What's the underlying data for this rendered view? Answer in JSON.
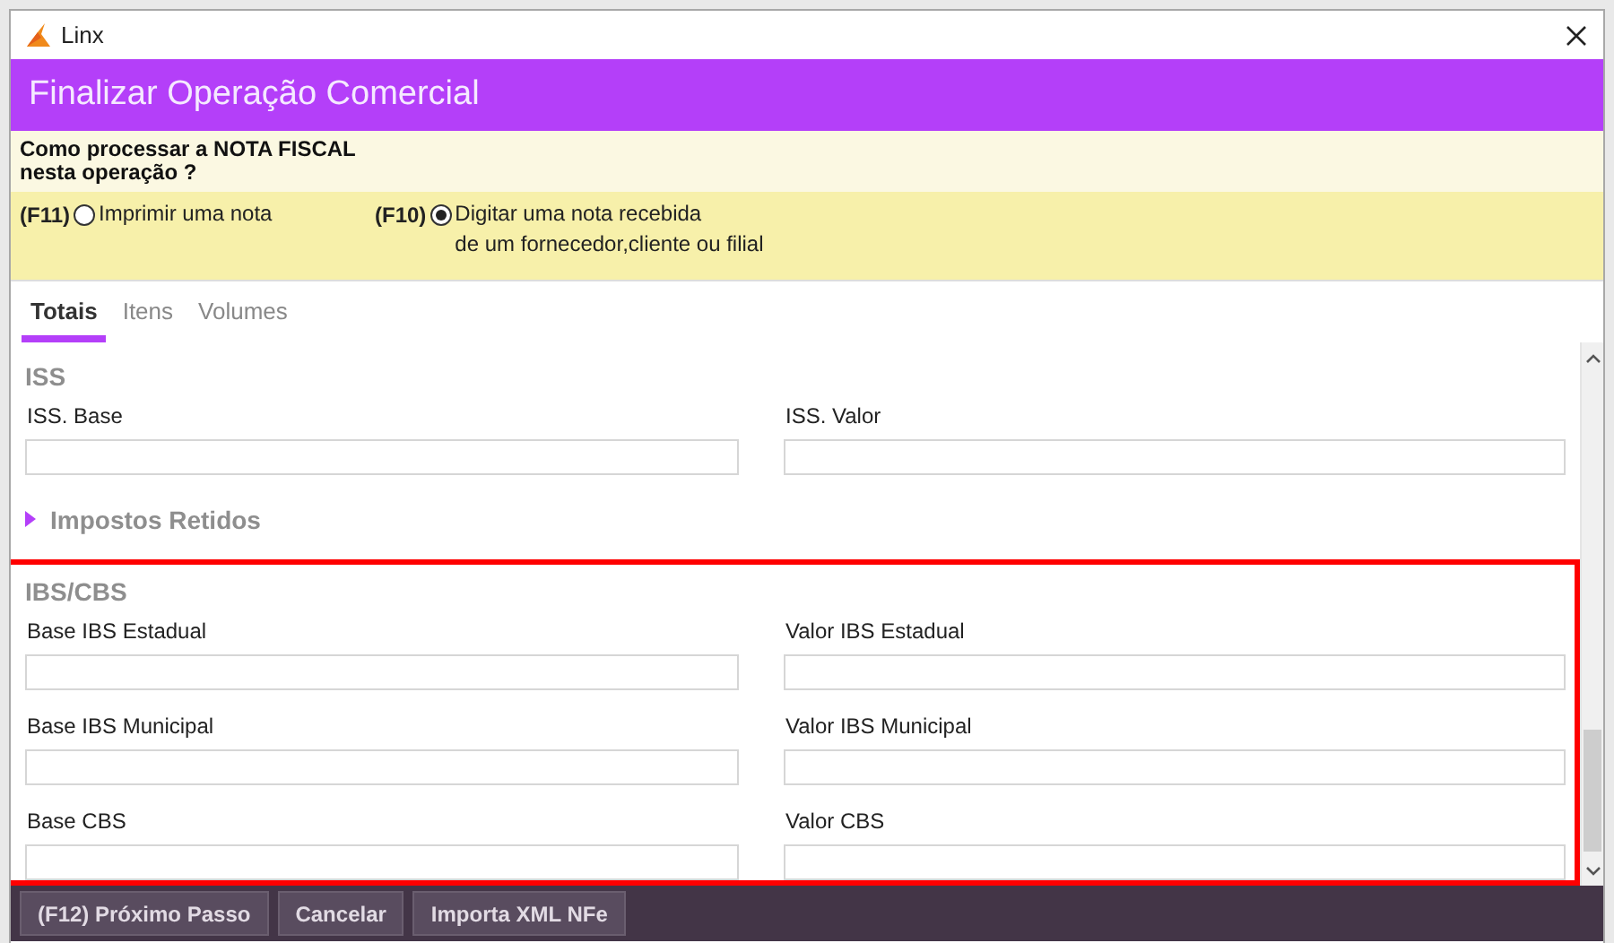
{
  "window": {
    "title": "Linx"
  },
  "header": {
    "title": "Finalizar Operação Comercial"
  },
  "question": {
    "lines": [
      "Como processar a NOTA FISCAL",
      "nesta operação ?"
    ]
  },
  "options": [
    {
      "shortcut": "(F11)",
      "label_lines": [
        "Imprimir uma nota"
      ],
      "selected": false
    },
    {
      "shortcut": "(F10)",
      "label_lines": [
        "Digitar uma nota recebida",
        "de um fornecedor,cliente ou filial"
      ],
      "selected": true
    }
  ],
  "tabs": [
    {
      "label": "Totais",
      "selected": true
    },
    {
      "label": "Itens",
      "selected": false
    },
    {
      "label": "Volumes",
      "selected": false
    }
  ],
  "sections": [
    {
      "kind": "fields",
      "title": "ISS",
      "fields": [
        {
          "label": "ISS. Base"
        },
        {
          "label": "ISS. Valor"
        }
      ]
    },
    {
      "kind": "collapsible",
      "title": "Impostos Retidos",
      "expanded": false
    },
    {
      "kind": "fields",
      "title": "IBS/CBS",
      "highlighted": true,
      "fields": [
        {
          "label": "Base IBS Estadual"
        },
        {
          "label": "Valor IBS Estadual"
        },
        {
          "label": "Base IBS Municipal"
        },
        {
          "label": "Valor IBS Municipal"
        },
        {
          "label": "Base CBS"
        },
        {
          "label": "Valor CBS"
        }
      ]
    }
  ],
  "buttons": [
    "(F12) Próximo Passo",
    "Cancelar",
    "Importa XML NFe"
  ]
}
